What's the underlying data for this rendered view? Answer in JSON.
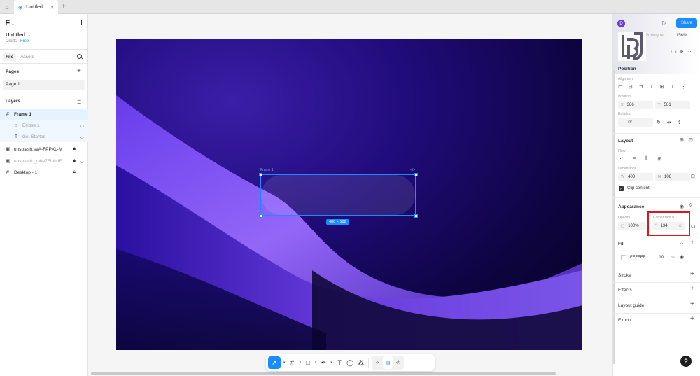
{
  "tabbar": {
    "file_tab": "Untitled",
    "add": "+"
  },
  "left": {
    "file_title": "Untitled",
    "drafts": "Drafts",
    "plan": "Free",
    "tabs": [
      "File",
      "Assets"
    ],
    "pages_header": "Pages",
    "page": "Page 1",
    "layers_header": "Layers",
    "layers": [
      {
        "name": "Frame 1",
        "icon": "frame-icon"
      },
      {
        "name": "Ellipse 1",
        "icon": "ellipse-icon"
      },
      {
        "name": "Get Started",
        "icon": "text-icon"
      },
      {
        "name": "unsplash:seA-FPPXL-M",
        "icon": "image-icon"
      },
      {
        "name": "unsplash:_mbe7FIbbdE",
        "icon": "image-icon"
      },
      {
        "name": "Desktop - 1",
        "icon": "frame-icon"
      }
    ]
  },
  "canvas": {
    "size_badge": "400 × 108",
    "frame_label": "Frame 1",
    "frame_code": "</>"
  },
  "right": {
    "avatar": "D",
    "share": "Share",
    "zoom": "156%",
    "prototype": "Prototype",
    "position": {
      "title": "Position",
      "alignment_label": "Alignment",
      "position_label": "Position",
      "x_prefix": "X",
      "x": "386",
      "y_prefix": "Y",
      "y": "581",
      "rotation_label": "Rotation",
      "rotation": "0°"
    },
    "layout": {
      "title": "Layout",
      "flow_label": "Flow",
      "dimensions_label": "Dimensions",
      "w_prefix": "W",
      "w": "400",
      "h_prefix": "H",
      "h": "108",
      "clip": "Clip content"
    },
    "appearance": {
      "title": "Appearance",
      "opacity_label": "Opacity",
      "opacity": "100%",
      "radius_label": "Corner radius",
      "radius": "134"
    },
    "fill": {
      "title": "Fill",
      "hex": "FFFFFF",
      "opacity": "10",
      "pct": "%"
    },
    "sections": [
      "Stroke",
      "Effects",
      "Layout guide",
      "Export"
    ],
    "help": "?"
  },
  "colors": {
    "accent": "#1a8cff",
    "highlight": "#e0141e"
  }
}
